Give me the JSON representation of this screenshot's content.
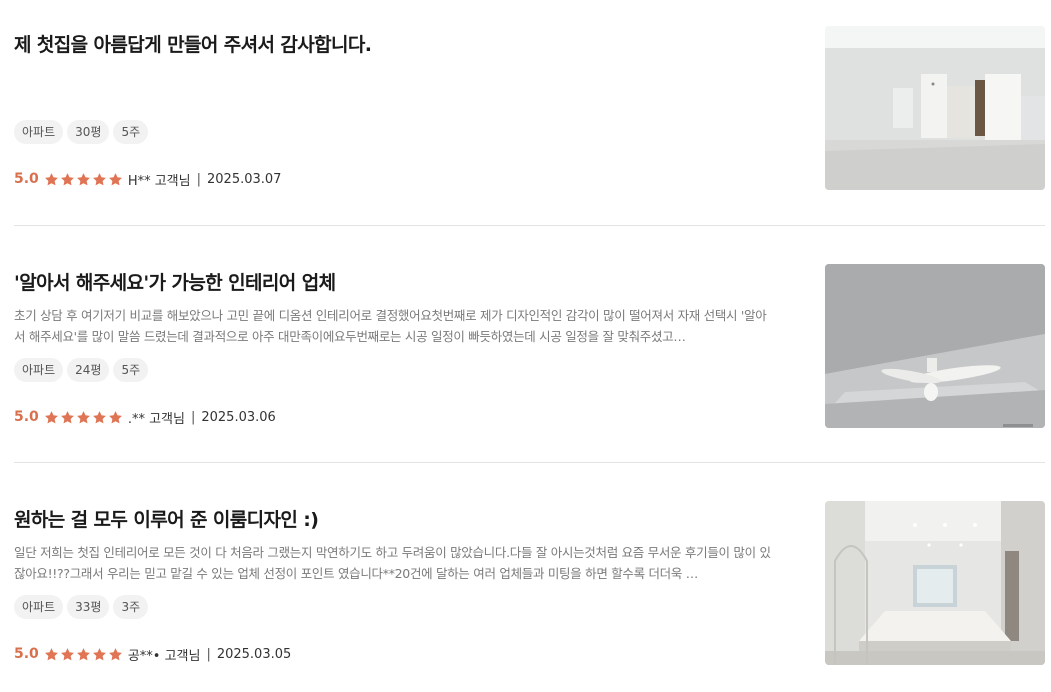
{
  "reviews": [
    {
      "title": "제 첫집을 아름답게 만들어 주셔서 감사합니다.",
      "excerpt": "",
      "tags": [
        "아파트",
        "30평",
        "5주"
      ],
      "rating": "5.0",
      "stars": 5,
      "reviewer": "H** 고객님",
      "date": "2025.03.07",
      "photo": "white-living-room-photo"
    },
    {
      "title": "'알아서 해주세요'가 가능한 인테리어 업체",
      "excerpt": "초기 상담 후 여기저기 비교를 해보았으나 고민 끝에 디옴션 인테리어로 결정했어요첫번째로 제가 디자인적인 감각이 많이 떨어져서 자재 선택시 '알아서 해주세요'를 많이 말씀 드렸는데 결과적으로 아주 대만족이에요두번째로는 시공 일정이 빠듯하였는데 시공 일정을 잘 맞춰주셨고…",
      "tags": [
        "아파트",
        "24평",
        "5주"
      ],
      "rating": "5.0",
      "stars": 5,
      "reviewer": ".** 고객님",
      "date": "2025.03.06",
      "photo": "ceiling-fan-photo"
    },
    {
      "title": "원하는 걸 모두 이루어 준 이룸디자인 :)",
      "excerpt": "일단 저희는 첫집 인테리어로 모든 것이 다 처음라 그랬는지 막연하기도 하고 두려움이 많았습니다.다들 잘 아시는것처럼 요즘 무서운 후기들이 많이 있잖아요!!??그래서 우리는 믿고 맡길 수 있는 업체 선정이 포인트 였습니다**20건에 달하는 여러 업체들과 미팅을 하면 할수록 더더욱 …",
      "tags": [
        "아파트",
        "33평",
        "3주"
      ],
      "rating": "5.0",
      "stars": 5,
      "reviewer": "공**• 고객님",
      "date": "2025.03.05",
      "photo": "kitchen-island-photo"
    }
  ],
  "meta_separator": "|",
  "colors": {
    "star": "#e07555",
    "rating": "#d9704d",
    "tag_bg": "#f2f2f2",
    "divider": "#e4e4e4"
  }
}
